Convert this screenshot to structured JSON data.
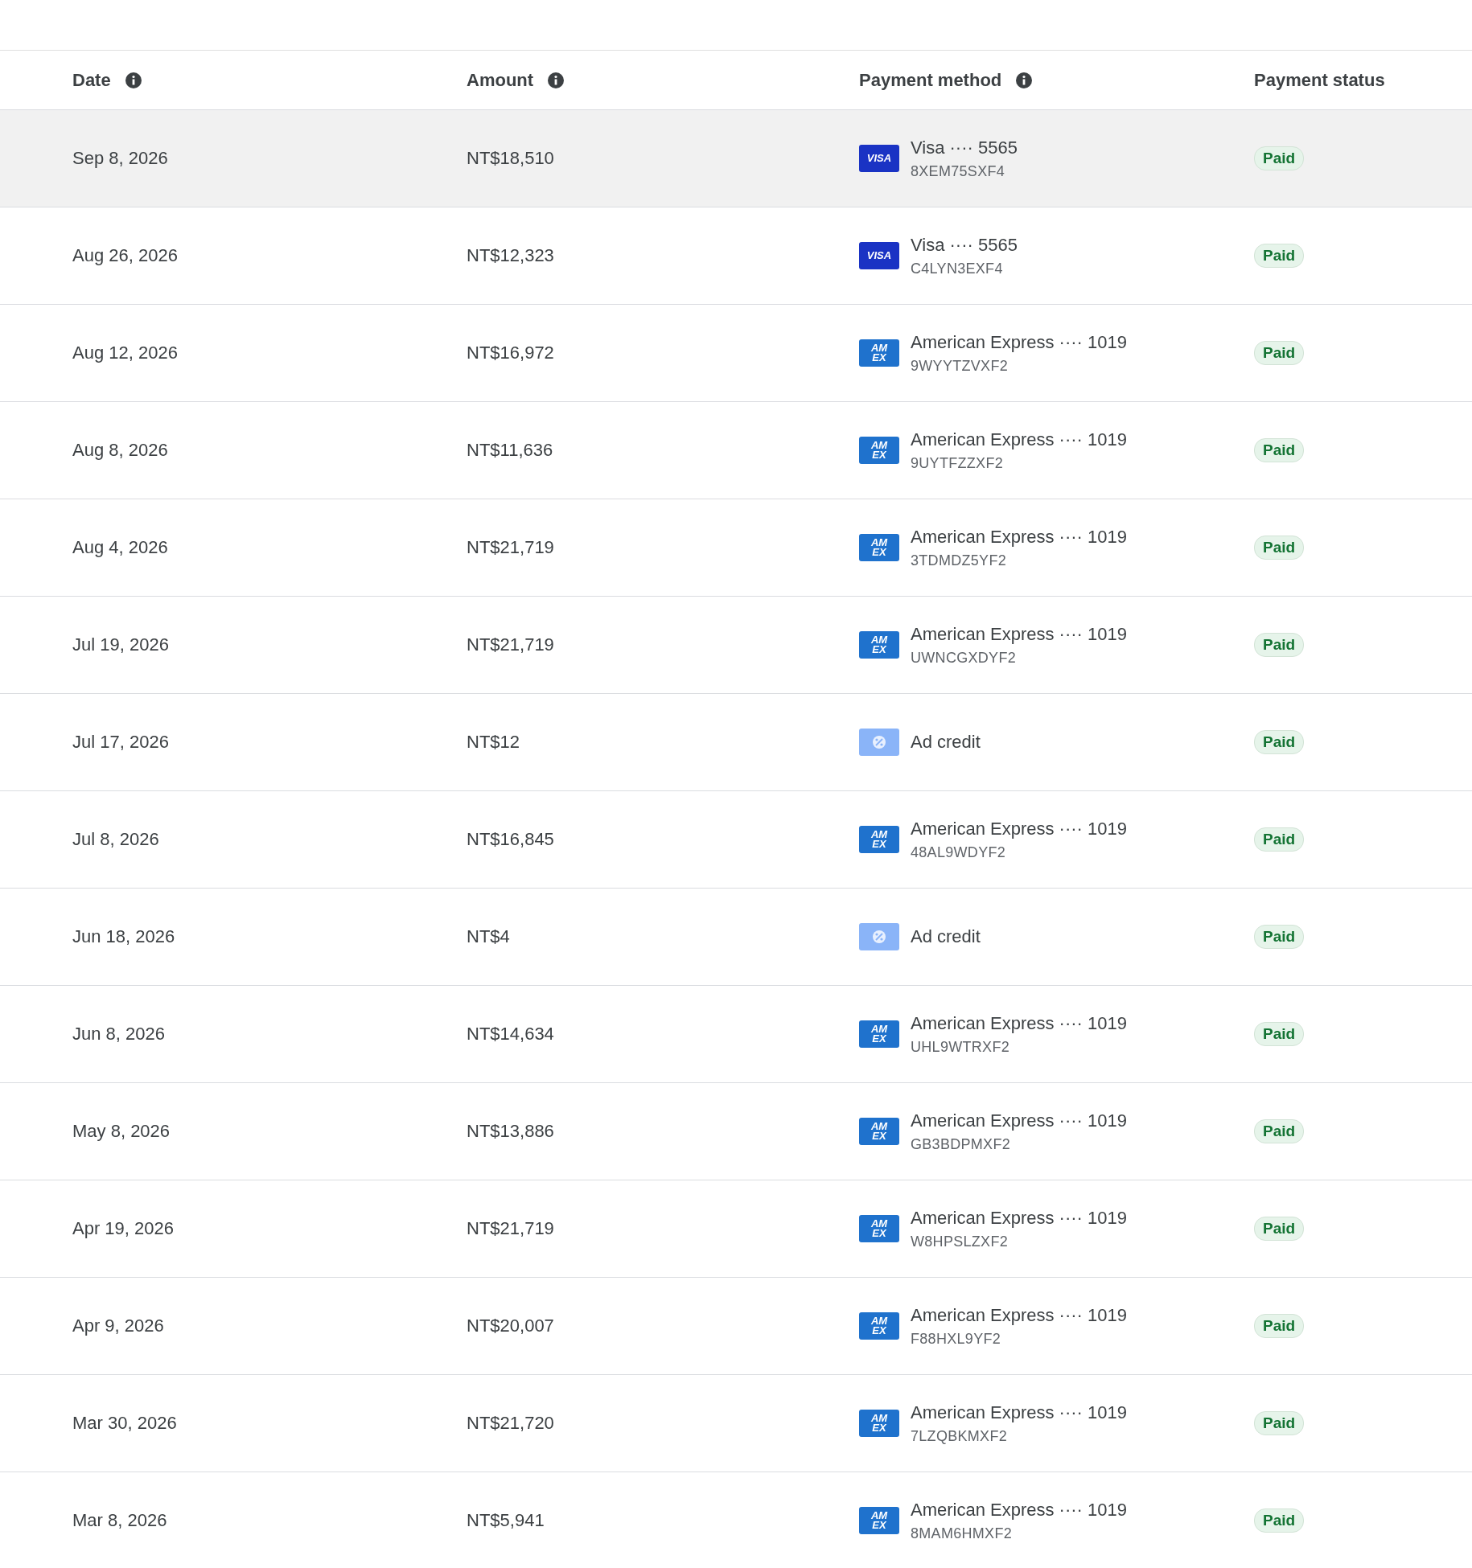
{
  "table": {
    "columns": [
      {
        "label": "Date",
        "info": true
      },
      {
        "label": "Amount",
        "info": true
      },
      {
        "label": "Payment method",
        "info": true
      },
      {
        "label": "Payment status",
        "info": false
      }
    ],
    "rows": [
      {
        "date": "Sep 8, 2026",
        "amount": "NT$18,510",
        "method": {
          "kind": "visa",
          "logo": [
            "VISA"
          ],
          "name": "Visa ···· 5565",
          "ref": "8XEM75SXF4"
        },
        "status": "Paid",
        "selected": true
      },
      {
        "date": "Aug 26, 2026",
        "amount": "NT$12,323",
        "method": {
          "kind": "visa",
          "logo": [
            "VISA"
          ],
          "name": "Visa ···· 5565",
          "ref": "C4LYN3EXF4"
        },
        "status": "Paid",
        "selected": false
      },
      {
        "date": "Aug 12, 2026",
        "amount": "NT$16,972",
        "method": {
          "kind": "amex",
          "logo": [
            "AM",
            "EX"
          ],
          "name": "American Express ···· 1019",
          "ref": "9WYYTZVXF2"
        },
        "status": "Paid",
        "selected": false
      },
      {
        "date": "Aug 8, 2026",
        "amount": "NT$11,636",
        "method": {
          "kind": "amex",
          "logo": [
            "AM",
            "EX"
          ],
          "name": "American Express ···· 1019",
          "ref": "9UYTFZZXF2"
        },
        "status": "Paid",
        "selected": false
      },
      {
        "date": "Aug 4, 2026",
        "amount": "NT$21,719",
        "method": {
          "kind": "amex",
          "logo": [
            "AM",
            "EX"
          ],
          "name": "American Express ···· 1019",
          "ref": "3TDMDZ5YF2"
        },
        "status": "Paid",
        "selected": false
      },
      {
        "date": "Jul 19, 2026",
        "amount": "NT$21,719",
        "method": {
          "kind": "amex",
          "logo": [
            "AM",
            "EX"
          ],
          "name": "American Express ···· 1019",
          "ref": "UWNCGXDYF2"
        },
        "status": "Paid",
        "selected": false
      },
      {
        "date": "Jul 17, 2026",
        "amount": "NT$12",
        "method": {
          "kind": "credit",
          "name": "Ad credit"
        },
        "status": "Paid",
        "selected": false
      },
      {
        "date": "Jul 8, 2026",
        "amount": "NT$16,845",
        "method": {
          "kind": "amex",
          "logo": [
            "AM",
            "EX"
          ],
          "name": "American Express ···· 1019",
          "ref": "48AL9WDYF2"
        },
        "status": "Paid",
        "selected": false
      },
      {
        "date": "Jun 18, 2026",
        "amount": "NT$4",
        "method": {
          "kind": "credit",
          "name": "Ad credit"
        },
        "status": "Paid",
        "selected": false
      },
      {
        "date": "Jun 8, 2026",
        "amount": "NT$14,634",
        "method": {
          "kind": "amex",
          "logo": [
            "AM",
            "EX"
          ],
          "name": "American Express ···· 1019",
          "ref": "UHL9WTRXF2"
        },
        "status": "Paid",
        "selected": false
      },
      {
        "date": "May 8, 2026",
        "amount": "NT$13,886",
        "method": {
          "kind": "amex",
          "logo": [
            "AM",
            "EX"
          ],
          "name": "American Express ···· 1019",
          "ref": "GB3BDPMXF2"
        },
        "status": "Paid",
        "selected": false
      },
      {
        "date": "Apr 19, 2026",
        "amount": "NT$21,719",
        "method": {
          "kind": "amex",
          "logo": [
            "AM",
            "EX"
          ],
          "name": "American Express ···· 1019",
          "ref": "W8HPSLZXF2"
        },
        "status": "Paid",
        "selected": false
      },
      {
        "date": "Apr 9, 2026",
        "amount": "NT$20,007",
        "method": {
          "kind": "amex",
          "logo": [
            "AM",
            "EX"
          ],
          "name": "American Express ···· 1019",
          "ref": "F88HXL9YF2"
        },
        "status": "Paid",
        "selected": false
      },
      {
        "date": "Mar 30, 2026",
        "amount": "NT$21,720",
        "method": {
          "kind": "amex",
          "logo": [
            "AM",
            "EX"
          ],
          "name": "American Express ···· 1019",
          "ref": "7LZQBKMXF2"
        },
        "status": "Paid",
        "selected": false
      },
      {
        "date": "Mar 8, 2026",
        "amount": "NT$5,941",
        "method": {
          "kind": "amex",
          "logo": [
            "AM",
            "EX"
          ],
          "name": "American Express ···· 1019",
          "ref": "8MAM6HMXF2"
        },
        "status": "Paid",
        "selected": false
      }
    ]
  }
}
